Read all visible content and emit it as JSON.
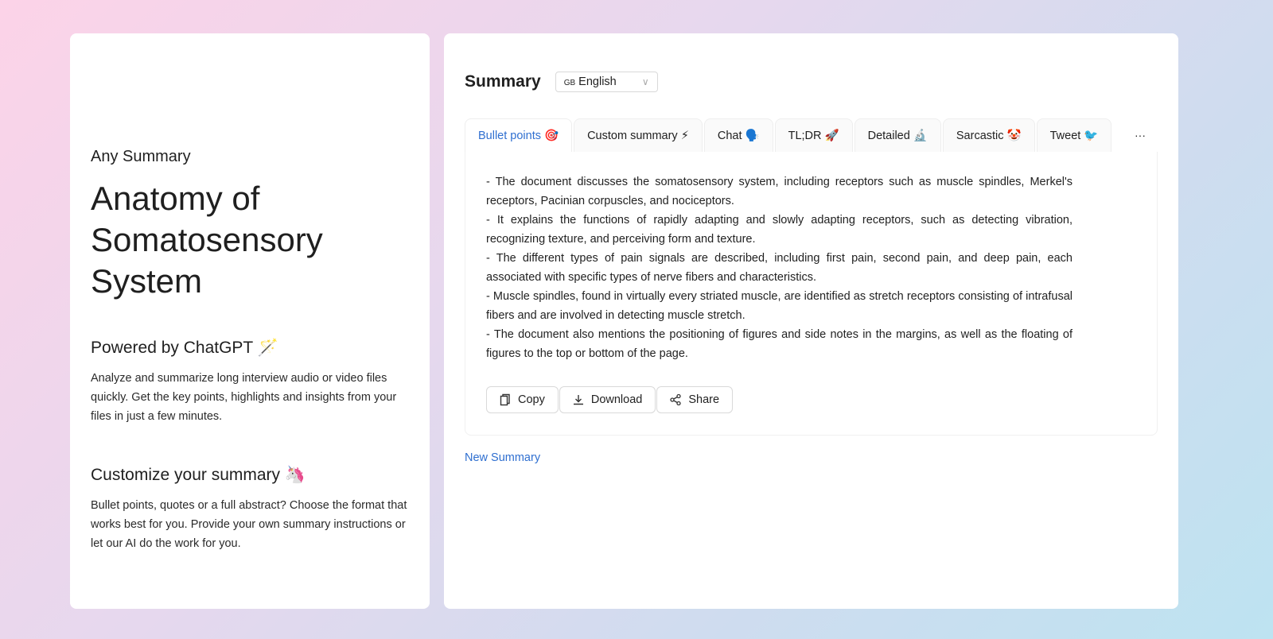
{
  "left": {
    "eyebrow": "Any Summary",
    "title": "Anatomy of Somatosensory System",
    "sections": [
      {
        "heading": "Powered by ChatGPT 🪄",
        "text": "Analyze and summarize long interview audio or video files quickly. Get the key points, highlights and insights from your files in just a few minutes."
      },
      {
        "heading": "Customize your summary 🦄",
        "text": "Bullet points, quotes or a full abstract? Choose the format that works best for you. Provide your own summary instructions or let our AI do the work for you."
      }
    ]
  },
  "summary": {
    "title": "Summary",
    "language": {
      "flag": "GB",
      "value": "English"
    },
    "tabs": [
      {
        "label": "Bullet points 🎯"
      },
      {
        "label": "Custom summary ⚡"
      },
      {
        "label": "Chat 🗣️"
      },
      {
        "label": "TL;DR 🚀"
      },
      {
        "label": "Detailed 🔬"
      },
      {
        "label": "Sarcastic 🤡"
      },
      {
        "label": "Tweet 🐦"
      }
    ],
    "more": "···",
    "bullets": [
      "- The document discusses the somatosensory system, including receptors such as muscle spindles, Merkel's receptors, Pacinian corpuscles, and nociceptors.",
      "- It explains the functions of rapidly adapting and slowly adapting receptors, such as detecting vibration, recognizing texture, and perceiving form and texture.",
      "- The different types of pain signals are described, including first pain, second pain, and deep pain, each associated with specific types of nerve fibers and characteristics.",
      "- Muscle spindles, found in virtually every striated muscle, are identified as stretch receptors consisting of intrafusal fibers and are involved in detecting muscle stretch.",
      "- The document also mentions the positioning of figures and side notes in the margins, as well as the floating of figures to the top or bottom of the page."
    ],
    "actions": {
      "copy": "Copy",
      "download": "Download",
      "share": "Share"
    },
    "new_summary": "New Summary"
  },
  "colors": {
    "accent": "#2f6fd0"
  }
}
